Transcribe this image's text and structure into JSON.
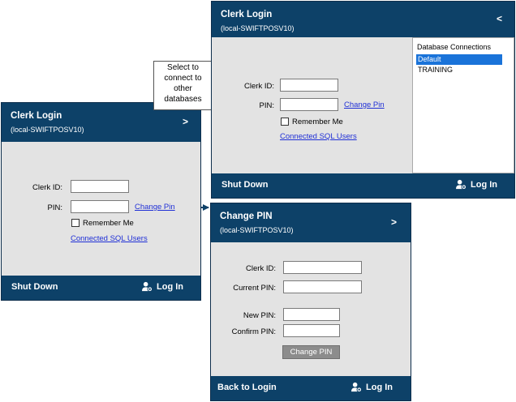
{
  "colors": {
    "header": "#0d4168",
    "window_bg": "#e3e3e3",
    "link": "#1f2fd6",
    "selection": "#1a73d9"
  },
  "callout": {
    "lines": [
      "Select to",
      "connect to",
      "other",
      "databases"
    ]
  },
  "login_small": {
    "title": "Clerk Login",
    "subtitle": "(local-SWIFTPOSV10)",
    "toggle": ">",
    "clerk_id_label": "Clerk ID:",
    "clerk_id_value": "",
    "pin_label": "PIN:",
    "pin_value": "",
    "change_pin": "Change Pin",
    "remember_me": "Remember Me",
    "connected_users": "Connected SQL Users",
    "shut_down": "Shut Down",
    "log_in": "Log In",
    "login_icon": "user-login-icon"
  },
  "login_expanded": {
    "title": "Clerk Login",
    "subtitle": "(local-SWIFTPOSV10)",
    "toggle": "<",
    "clerk_id_label": "Clerk ID:",
    "clerk_id_value": "",
    "pin_label": "PIN:",
    "pin_value": "",
    "change_pin": "Change Pin",
    "remember_me": "Remember Me",
    "connected_users": "Connected SQL Users",
    "shut_down": "Shut Down",
    "log_in": "Log In",
    "login_icon": "user-login-icon",
    "db_list": {
      "header": "Database Connections",
      "items": [
        "Default",
        "TRAINING"
      ],
      "selected": "Default"
    }
  },
  "change_pin": {
    "title": "Change PIN",
    "subtitle": "(local-SWIFTPOSV10)",
    "toggle": ">",
    "clerk_id_label": "Clerk ID:",
    "current_pin_label": "Current PIN:",
    "new_pin_label": "New PIN:",
    "confirm_pin_label": "Confirm PIN:",
    "clerk_id_value": "",
    "current_pin_value": "",
    "new_pin_value": "",
    "confirm_pin_value": "",
    "submit": "Change PIN",
    "back": "Back to Login",
    "log_in": "Log In",
    "login_icon": "user-login-icon"
  }
}
